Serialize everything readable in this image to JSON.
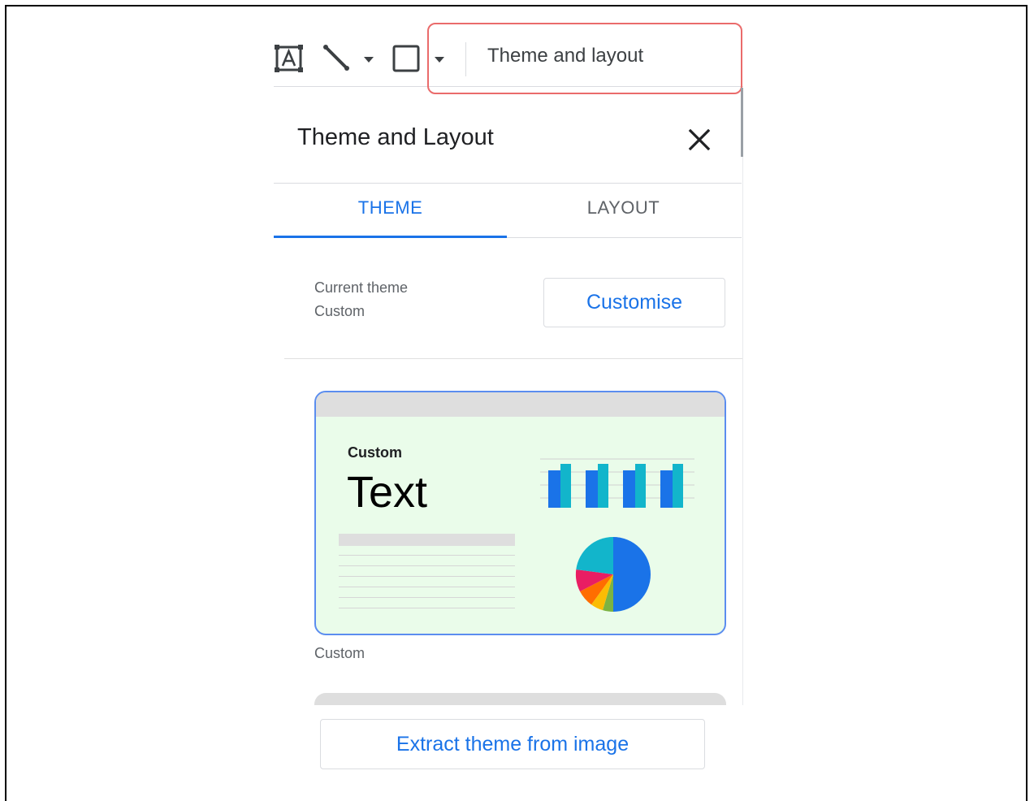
{
  "toolbar": {
    "icons": [
      "text-box-icon",
      "line-icon",
      "dropdown-arrow-icon",
      "shape-rectangle-icon",
      "dropdown-arrow-icon"
    ],
    "theme_layout_label": "Theme and layout"
  },
  "panel": {
    "title": "Theme and Layout",
    "close_icon": "close-icon",
    "tabs": [
      {
        "label": "THEME",
        "selected": true
      },
      {
        "label": "LAYOUT",
        "selected": false
      }
    ],
    "current_theme_label": "Current theme",
    "current_theme_value": "Custom",
    "customise_label": "Customise",
    "theme_card": {
      "small_text": "Custom",
      "big_text": "Text",
      "caption": "Custom"
    },
    "extract_label": "Extract theme from image"
  },
  "colors": {
    "accent": "#1a73e8",
    "highlight": "#ea6b6b",
    "card_background": "#eafcea",
    "card_border": "#5b8def"
  }
}
